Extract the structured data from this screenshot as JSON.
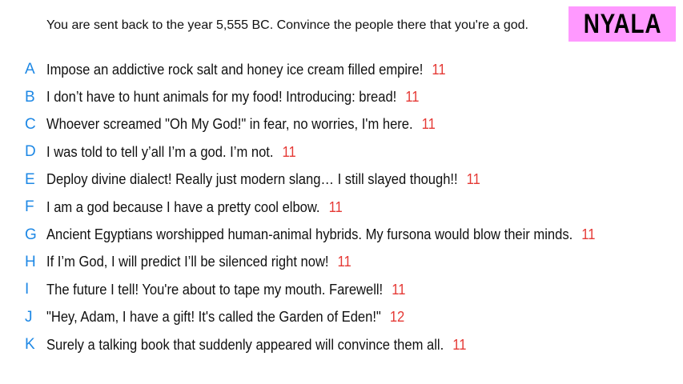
{
  "prompt": "You are sent back to the year 5,555 BC. Convince the people there that you're a god.",
  "player_name": "NYALA",
  "colors": {
    "badge": "#ff99ff",
    "letter": "#1e88e5",
    "score": "#e53935"
  },
  "answers": [
    {
      "letter": "A",
      "text": "Impose an addictive rock salt and honey ice cream filled empire!",
      "score": "11"
    },
    {
      "letter": "B",
      "text": "I don’t have to hunt animals for my food! Introducing: bread!",
      "score": "11"
    },
    {
      "letter": "C",
      "text": "Whoever screamed \"Oh My God!\" in fear, no worries, I'm here.",
      "score": "11"
    },
    {
      "letter": "D",
      "text": "I was told to tell y’all I’m a god. I’m not.",
      "score": "11"
    },
    {
      "letter": "E",
      "text": "Deploy divine dialect! Really just modern slang… I still slayed though!!",
      "score": "11"
    },
    {
      "letter": "F",
      "text": "I am a god because I have a pretty cool elbow.",
      "score": "11"
    },
    {
      "letter": "G",
      "text": "Ancient Egyptians worshipped human-animal hybrids. My fursona would blow their minds.",
      "score": "11"
    },
    {
      "letter": "H",
      "text": "If I’m God, I will predict I’ll be silenced right now!",
      "score": "11"
    },
    {
      "letter": "I",
      "text": "The future I tell! You're about to tape my mouth. Farewell!",
      "score": "11"
    },
    {
      "letter": "J",
      "text": "\"Hey, Adam, I have a gift! It's called the Garden of Eden!\"",
      "score": "12"
    },
    {
      "letter": "K",
      "text": "Surely a talking book that suddenly appeared will convince them all.",
      "score": "11"
    }
  ]
}
